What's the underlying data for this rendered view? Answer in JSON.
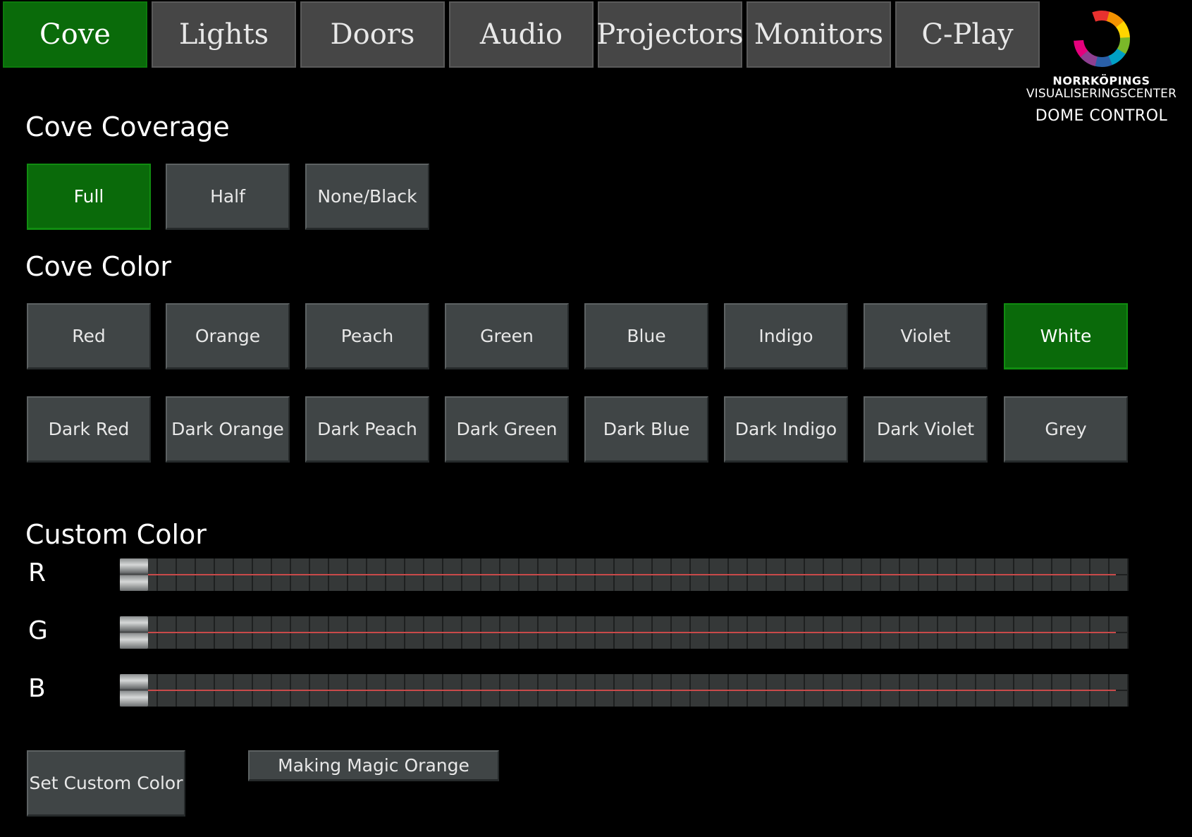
{
  "tabs": [
    {
      "label": "Cove",
      "active": true
    },
    {
      "label": "Lights",
      "active": false
    },
    {
      "label": "Doors",
      "active": false
    },
    {
      "label": "Audio",
      "active": false
    },
    {
      "label": "Projectors",
      "active": false
    },
    {
      "label": "Monitors",
      "active": false
    },
    {
      "label": "C-Play",
      "active": false
    }
  ],
  "brand": {
    "line1": "NORRKÖPINGS",
    "line2": "VISUALISERINGSCENTER",
    "line3": "DOME CONTROL",
    "logo_icon": "ring-logo-icon",
    "logo_colors": [
      "#e8312f",
      "#f39200",
      "#ffd500",
      "#7ab829",
      "#00a0c6",
      "#2a5fa8",
      "#8e3f91",
      "#e5007d"
    ]
  },
  "coverage": {
    "title": "Cove Coverage",
    "options": [
      {
        "label": "Full",
        "active": true
      },
      {
        "label": "Half",
        "active": false
      },
      {
        "label": "None/Black",
        "active": false
      }
    ]
  },
  "color": {
    "title": "Cove Color",
    "row1": [
      {
        "label": "Red",
        "active": false
      },
      {
        "label": "Orange",
        "active": false
      },
      {
        "label": "Peach",
        "active": false
      },
      {
        "label": "Green",
        "active": false
      },
      {
        "label": "Blue",
        "active": false
      },
      {
        "label": "Indigo",
        "active": false
      },
      {
        "label": "Violet",
        "active": false
      },
      {
        "label": "White",
        "active": true
      }
    ],
    "row2": [
      {
        "label": "Dark Red",
        "active": false
      },
      {
        "label": "Dark Orange",
        "active": false
      },
      {
        "label": "Dark Peach",
        "active": false
      },
      {
        "label": "Dark Green",
        "active": false
      },
      {
        "label": "Dark Blue",
        "active": false
      },
      {
        "label": "Dark Indigo",
        "active": false
      },
      {
        "label": "Dark Violet",
        "active": false
      },
      {
        "label": "Grey",
        "active": false
      }
    ]
  },
  "custom": {
    "title": "Custom Color",
    "sliders": [
      {
        "label": "R",
        "value": 0
      },
      {
        "label": "G",
        "value": 0
      },
      {
        "label": "B",
        "value": 0
      }
    ],
    "set_label": "Set Custom Color",
    "status": "Making Magic Orange"
  },
  "colors": {
    "active": "#0a6a0a",
    "button": "#404546",
    "track": "#c94a4a"
  }
}
